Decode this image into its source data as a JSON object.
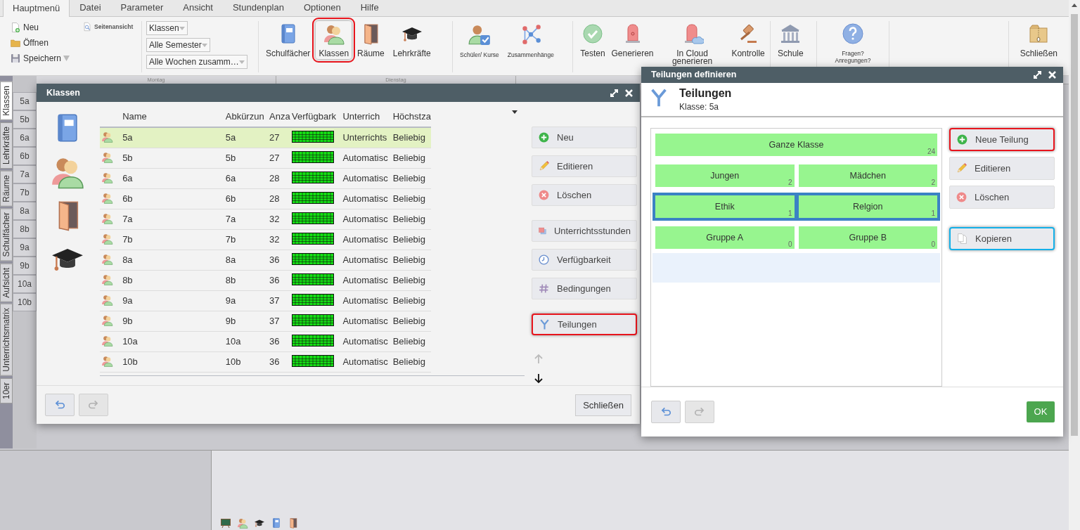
{
  "menu": [
    {
      "label": "Hauptmenü",
      "selected": true
    },
    {
      "label": "Datei",
      "selected": false
    },
    {
      "label": "Parameter",
      "selected": false
    },
    {
      "label": "Ansicht",
      "selected": false
    },
    {
      "label": "Stundenplan",
      "selected": false
    },
    {
      "label": "Optionen",
      "selected": false
    },
    {
      "label": "Hilfe",
      "selected": false
    }
  ],
  "ribbon": {
    "file_actions": [
      {
        "kind": "new",
        "label": "Neu"
      },
      {
        "kind": "open",
        "label": "Öffnen"
      },
      {
        "kind": "save",
        "label": "Speichern"
      }
    ],
    "page_view": {
      "kind": "preview",
      "label": "Seitenansicht"
    },
    "dropdowns": [
      {
        "value": "Klassen"
      },
      {
        "value": "Alle Semester"
      },
      {
        "value": "Alle Wochen zusamm…"
      }
    ],
    "groups": [
      {
        "compact": false,
        "buttons": [
          {
            "kind": "book",
            "label": "Schulfächer",
            "highlighted": false
          },
          {
            "kind": "people",
            "label": "Klassen",
            "highlighted": true,
            "color": "#e8141c"
          },
          {
            "kind": "door",
            "label": "Räume",
            "highlighted": false
          },
          {
            "kind": "cap",
            "label": "Lehrkräfte",
            "highlighted": false
          }
        ]
      },
      {
        "compact": true,
        "buttons": [
          {
            "kind": "student",
            "label": "Schüler/ Kurse",
            "highlighted": false
          },
          {
            "kind": "network",
            "label": "Zusammenhänge",
            "highlighted": false
          }
        ]
      },
      {
        "compact": false,
        "buttons": [
          {
            "kind": "check",
            "label": "Testen",
            "highlighted": false
          },
          {
            "kind": "siren",
            "label": "Generieren",
            "highlighted": false
          },
          {
            "kind": "cloud",
            "label": "In Cloud generieren",
            "highlighted": false
          },
          {
            "kind": "gavel",
            "label": "Kontrolle",
            "highlighted": false
          }
        ]
      },
      {
        "compact": false,
        "buttons": [
          {
            "kind": "building",
            "label": "Schule",
            "highlighted": false
          }
        ]
      },
      {
        "compact": true,
        "buttons": [
          {
            "kind": "question",
            "label": "Fragen? Anregungen?",
            "highlighted": false
          }
        ]
      }
    ],
    "close": {
      "kind": "box",
      "label": "Schließen"
    }
  },
  "side_tabs": [
    {
      "label": "Klassen",
      "selected": true
    },
    {
      "label": "Lehrkräfte",
      "selected": false
    },
    {
      "label": "Räume",
      "selected": false
    },
    {
      "label": "Schulfächer",
      "selected": false
    },
    {
      "label": "Aufsicht",
      "selected": false
    },
    {
      "label": "Unterrichtsmatrix",
      "selected": false
    },
    {
      "label": "10er",
      "selected": false
    }
  ],
  "timetable": {
    "days": [
      "Montag",
      "Dienstag"
    ],
    "classes": [
      "5a",
      "5b",
      "6a",
      "6b",
      "7a",
      "7b",
      "8a",
      "8b",
      "9a",
      "9b",
      "10a",
      "10b"
    ]
  },
  "klassen_dialog": {
    "title": "Klassen",
    "columns": [
      "Name",
      "Abkürzun",
      "Anza",
      "Verfügbark",
      "Unterrich",
      "Höchstza"
    ],
    "rows": [
      {
        "name": "5a",
        "abbr": "5a",
        "count": "27",
        "mode": "Unterrichts",
        "max": "Beliebig",
        "selected": true
      },
      {
        "name": "5b",
        "abbr": "5b",
        "count": "27",
        "mode": "Automatisc",
        "max": "Beliebig",
        "selected": false
      },
      {
        "name": "6a",
        "abbr": "6a",
        "count": "28",
        "mode": "Automatisc",
        "max": "Beliebig",
        "selected": false
      },
      {
        "name": "6b",
        "abbr": "6b",
        "count": "28",
        "mode": "Automatisc",
        "max": "Beliebig",
        "selected": false
      },
      {
        "name": "7a",
        "abbr": "7a",
        "count": "32",
        "mode": "Automatisc",
        "max": "Beliebig",
        "selected": false
      },
      {
        "name": "7b",
        "abbr": "7b",
        "count": "32",
        "mode": "Automatisc",
        "max": "Beliebig",
        "selected": false
      },
      {
        "name": "8a",
        "abbr": "8a",
        "count": "36",
        "mode": "Automatisc",
        "max": "Beliebig",
        "selected": false
      },
      {
        "name": "8b",
        "abbr": "8b",
        "count": "36",
        "mode": "Automatisc",
        "max": "Beliebig",
        "selected": false
      },
      {
        "name": "9a",
        "abbr": "9a",
        "count": "37",
        "mode": "Automatisc",
        "max": "Beliebig",
        "selected": false
      },
      {
        "name": "9b",
        "abbr": "9b",
        "count": "37",
        "mode": "Automatisc",
        "max": "Beliebig",
        "selected": false
      },
      {
        "name": "10a",
        "abbr": "10a",
        "count": "36",
        "mode": "Automatisc",
        "max": "Beliebig",
        "selected": false
      },
      {
        "name": "10b",
        "abbr": "10b",
        "count": "36",
        "mode": "Automatisc",
        "max": "Beliebig",
        "selected": false
      }
    ],
    "action_groups": [
      [
        {
          "kind": "add",
          "label": "Neu",
          "highlighted": false
        },
        {
          "kind": "edit",
          "label": "Editieren",
          "highlighted": false
        },
        {
          "kind": "delete",
          "label": "Löschen",
          "highlighted": false
        }
      ],
      [
        {
          "kind": "lessons",
          "label": "Unterrichtsstunden",
          "highlighted": false
        },
        {
          "kind": "clock",
          "label": "Verfügbarkeit",
          "highlighted": false
        },
        {
          "kind": "hash",
          "label": "Bedingungen",
          "highlighted": false
        }
      ],
      [
        {
          "kind": "fork",
          "label": "Teilungen",
          "highlighted": true,
          "color": "#e8141c"
        }
      ]
    ],
    "move_up": {
      "disabled": true
    },
    "move_down": {
      "disabled": false
    },
    "undo": {
      "disabled": false
    },
    "redo": {
      "disabled": true
    },
    "close": "Schließen"
  },
  "teilungen_dialog": {
    "title": "Teilungen definieren",
    "heading": "Teilungen",
    "subheading": "Klasse: 5a",
    "divisions": [
      {
        "selected": false,
        "groups": [
          {
            "name": "Ganze Klasse",
            "count": "24"
          }
        ]
      },
      {
        "selected": false,
        "groups": [
          {
            "name": "Jungen",
            "count": "2"
          },
          {
            "name": "Mädchen",
            "count": "2"
          }
        ]
      },
      {
        "selected": true,
        "groups": [
          {
            "name": "Ethik",
            "count": "1"
          },
          {
            "name": "Relgion",
            "count": "1"
          }
        ]
      },
      {
        "selected": false,
        "groups": [
          {
            "name": "Gruppe A",
            "count": "0"
          },
          {
            "name": "Gruppe B",
            "count": "0"
          }
        ]
      }
    ],
    "actions": [
      {
        "kind": "add",
        "label": "Neue Teilung",
        "highlighted": true,
        "color": "#e8141c"
      },
      {
        "kind": "edit",
        "label": "Editieren",
        "highlighted": false
      },
      {
        "kind": "delete",
        "label": "Löschen",
        "highlighted": false
      },
      {
        "kind": "copy",
        "label": "Kopieren",
        "highlighted": true,
        "color": "#14b0e8"
      }
    ],
    "undo": {
      "disabled": false
    },
    "redo": {
      "disabled": true
    },
    "ok": "OK"
  }
}
